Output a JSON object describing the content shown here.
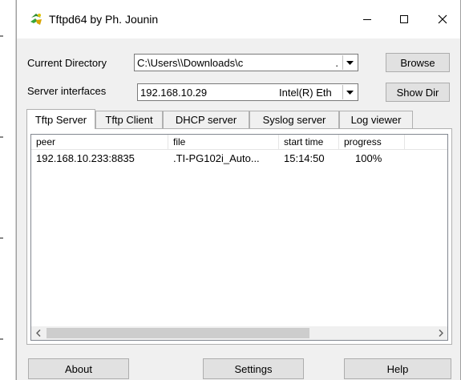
{
  "window": {
    "title": "Tftpd64 by Ph. Jounin",
    "controls": {
      "minimize": "—",
      "maximize": "☐",
      "close": "✕"
    }
  },
  "settings": {
    "current_directory_label": "Current Directory",
    "current_directory_value": "C:\\Users\\\\Downloads\\c",
    "current_directory_suffix": ".",
    "browse_label": "Browse",
    "server_interfaces_label": "Server interfaces",
    "server_interface_ip": "192.168.10.29",
    "server_interface_adapter": "Intel(R) Eth",
    "show_dir_label": "Show Dir"
  },
  "tabs": [
    {
      "label": "Tftp Server",
      "active": true
    },
    {
      "label": "Tftp Client",
      "active": false
    },
    {
      "label": "DHCP server",
      "active": false
    },
    {
      "label": "Syslog server",
      "active": false
    },
    {
      "label": "Log viewer",
      "active": false
    }
  ],
  "transfers": {
    "columns": [
      "peer",
      "file",
      "start time",
      "progress"
    ],
    "rows": [
      {
        "peer": "192.168.10.233:8835",
        "file": ".TI-PG102i_Auto...",
        "start_time": "15:14:50",
        "progress": "100%"
      }
    ]
  },
  "footer": {
    "about_label": "About",
    "settings_label": "Settings",
    "help_label": "Help"
  },
  "icons": {
    "app": "tftpd-app-icon",
    "dropdown": "chevron-down-icon",
    "scroll_left": "chevron-left-icon",
    "scroll_right": "chevron-right-icon"
  }
}
